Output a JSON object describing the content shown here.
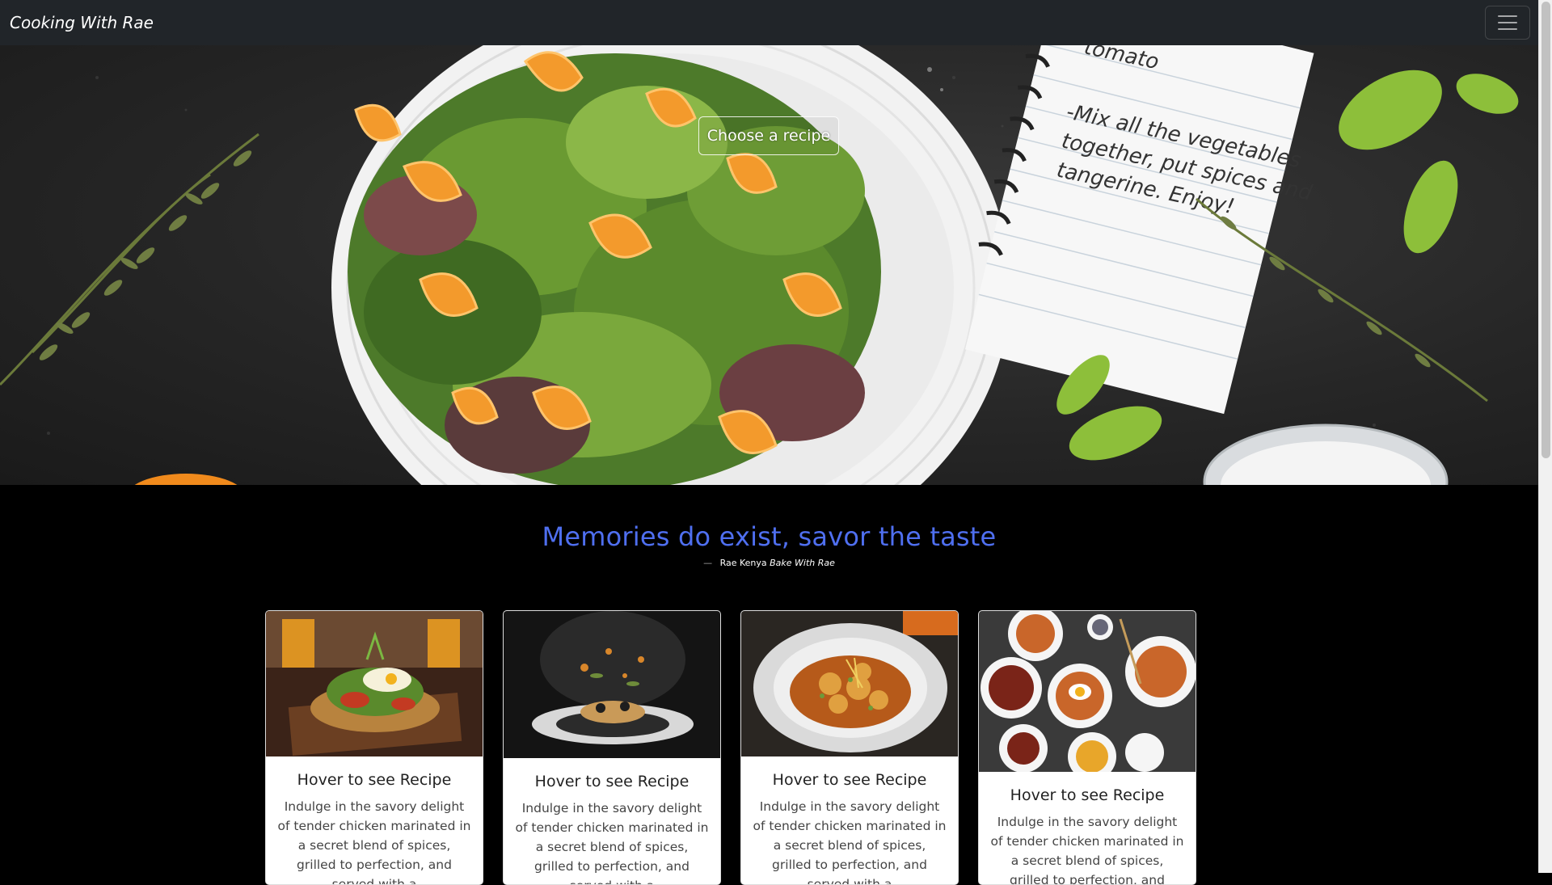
{
  "navbar": {
    "brand": "Cooking With Rae",
    "toggle_icon": "hamburger-menu-icon"
  },
  "hero": {
    "button_label": "Choose a recipe",
    "note_lines": [
      "-Mix all the vegetables",
      "together, put spices and",
      "tangerine. Enjoy!"
    ],
    "note_top_fragment": "tomato"
  },
  "quote": {
    "text": "Memories do exist, savor the taste",
    "author": "Rae Kenya",
    "source": "Bake With Rae"
  },
  "cards": [
    {
      "title": "Hover to see Recipe",
      "text": "Indulge in the savory delight of tender chicken marinated in a secret blend of spices, grilled to perfection, and served with a"
    },
    {
      "title": "Hover to see Recipe",
      "text": "Indulge in the savory delight of tender chicken marinated in a secret blend of spices, grilled to perfection, and served with a"
    },
    {
      "title": "Hover to see Recipe",
      "text": "Indulge in the savory delight of tender chicken marinated in a secret blend of spices, grilled to perfection, and served with a"
    },
    {
      "title": "Hover to see Recipe",
      "text": "Indulge in the savory delight of tender chicken marinated in a secret blend of spices, grilled to perfection, and served with a"
    }
  ],
  "colors": {
    "navbar_bg": "#212529",
    "accent": "#4f6ff0",
    "page_bg": "#000000"
  }
}
